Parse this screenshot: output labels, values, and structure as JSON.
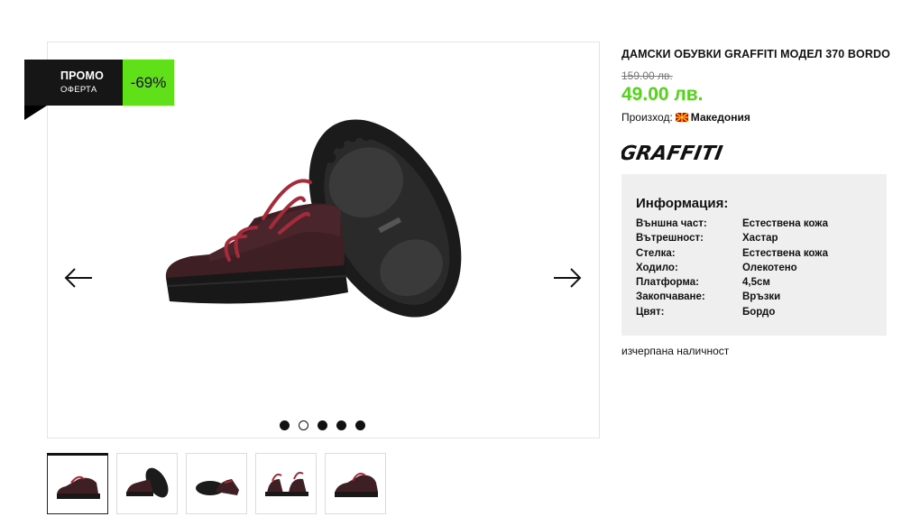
{
  "promo": {
    "title": "ПРОМО",
    "subtitle": "ОФЕРТА",
    "discount": "-69%",
    "badge_color": "#161616",
    "discount_color": "#5fe018"
  },
  "gallery": {
    "prev_icon": "arrow-left-icon",
    "next_icon": "arrow-right-icon",
    "dots_count": 5,
    "active_dot": 2,
    "thumbnails_count": 5,
    "selected_thumbnail": 1
  },
  "product": {
    "title": "ДАМСКИ ОБУВКИ GRAFFITI МОДЕЛ 370 BORDO",
    "old_price": "159.00 лв.",
    "new_price": "49.00 лв.",
    "price_color": "#54d21c",
    "origin_label": "Произход:",
    "origin_country": "Македония",
    "brand": "GRAFFITI"
  },
  "info": {
    "heading": "Информация:",
    "rows": [
      {
        "key": "Външна част:",
        "value": "Естествена кожа"
      },
      {
        "key": "Вътрешност:",
        "value": "Хастар"
      },
      {
        "key": "Стелка:",
        "value": "Естествена кожа"
      },
      {
        "key": "Ходило:",
        "value": "Олекотено"
      },
      {
        "key": "Платформа:",
        "value": "4,5см"
      },
      {
        "key": "Закопчаване:",
        "value": "Връзки"
      },
      {
        "key": "Цвят:",
        "value": "Бордо"
      }
    ]
  },
  "stock_status": "изчерпана наличност"
}
